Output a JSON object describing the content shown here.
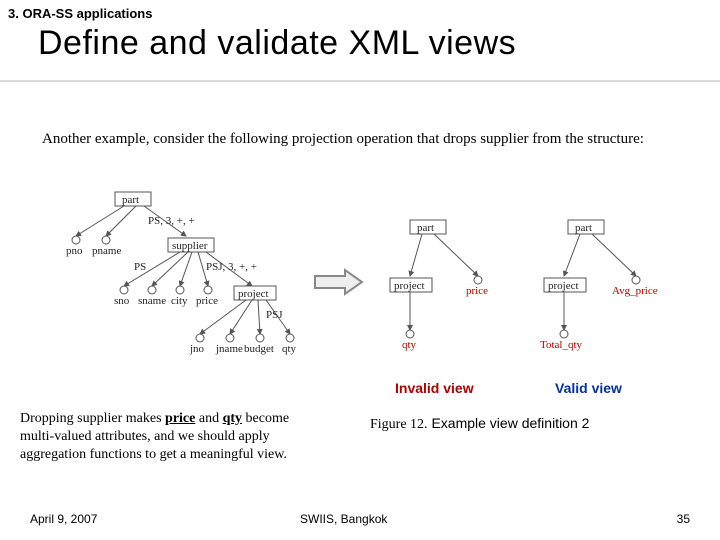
{
  "section_label": "3. ORA-SS applications",
  "title": "Define and validate XML views",
  "intro": "Another example, consider the following projection operation that drops supplier from the structure:",
  "diagram": {
    "left": {
      "nodes": [
        "part",
        "supplier",
        "project"
      ],
      "attrs": [
        "pno",
        "pname",
        "sno",
        "sname",
        "city",
        "price",
        "jno",
        "jname",
        "budget",
        "qty"
      ],
      "edges": [
        "PS, 3, +, +",
        "PS",
        "PSJ, 3, +, +",
        "PSJ"
      ]
    },
    "arrow": "⇒",
    "middle": {
      "nodes": [
        "part",
        "project"
      ],
      "attrs": [
        "price",
        "qty"
      ]
    },
    "right": {
      "nodes": [
        "part",
        "project"
      ],
      "attrs": [
        "Avg_price",
        "Total_qty"
      ]
    }
  },
  "caption_invalid": "Invalid view",
  "caption_valid": "Valid view",
  "fig_caption_prefix": "Figure 12.",
  "fig_caption_text": " Example view definition 2",
  "note_pre": "Dropping supplier makes ",
  "note_price": "price",
  "note_mid": " and ",
  "note_qty": "qty",
  "note_post": " become multi-valued attributes, and we should apply aggregation functions to get a meaningful view.",
  "footer": {
    "date": "April 9, 2007",
    "venue": "SWIIS, Bangkok",
    "page": "35"
  }
}
